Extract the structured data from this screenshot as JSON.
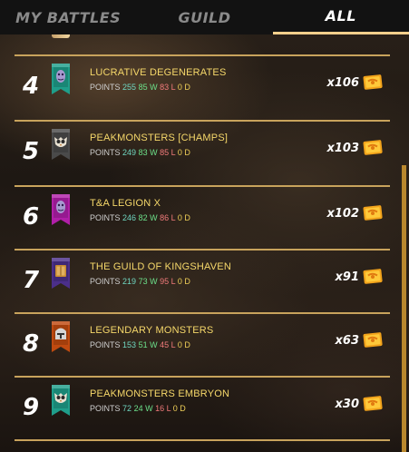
{
  "tabs": [
    {
      "label": "MY BATTLES",
      "active": false
    },
    {
      "label": "GUILD",
      "active": false
    },
    {
      "label": "ALL",
      "active": true
    }
  ],
  "colors": {
    "accent": "#f3cf8c",
    "guild_name": "#f6d86a",
    "points": "#6fd6c0",
    "wins": "#6ce08a",
    "losses": "#f07a7a",
    "draws": "#f0d058",
    "divider": "#c8a35c",
    "scrollbar": "#b9882e"
  },
  "rows": [
    {
      "rank": "4",
      "name": "LUCRATIVE DEGENERATES",
      "points_label": "POINTS",
      "points": "255",
      "w": "85 W",
      "l": "83 L",
      "d": "0 D",
      "multiplier": "x106",
      "banner": {
        "color": "#1f9e8a",
        "icon": "monster-icon"
      }
    },
    {
      "rank": "5",
      "name": "PEAKMONSTERS [CHAMPS]",
      "points_label": "POINTS",
      "points": "249",
      "w": "83 W",
      "l": "85 L",
      "d": "0 D",
      "multiplier": "x103",
      "banner": {
        "color": "#4a4a4a",
        "icon": "owl-skull-icon"
      }
    },
    {
      "rank": "6",
      "name": "T&A LEGION X",
      "points_label": "POINTS",
      "points": "246",
      "w": "82 W",
      "l": "86 L",
      "d": "0 D",
      "multiplier": "x102",
      "banner": {
        "color": "#b01fa8",
        "icon": "monster-icon"
      }
    },
    {
      "rank": "7",
      "name": "THE GUILD OF KINGSHAVEN",
      "points_label": "POINTS",
      "points": "219",
      "w": "73 W",
      "l": "95 L",
      "d": "0 D",
      "multiplier": "x91",
      "banner": {
        "color": "#4b2f8a",
        "icon": "book-icon"
      }
    },
    {
      "rank": "8",
      "name": "LEGENDARY MONSTERS",
      "points_label": "POINTS",
      "points": "153",
      "w": "51 W",
      "l": "45 L",
      "d": "0 D",
      "multiplier": "x63",
      "banner": {
        "color": "#c04a10",
        "icon": "helmet-icon"
      }
    },
    {
      "rank": "9",
      "name": "PEAKMONSTERS EMBRYON",
      "points_label": "POINTS",
      "points": "72",
      "w": "24 W",
      "l": "16 L",
      "d": "0 D",
      "multiplier": "x30",
      "banner": {
        "color": "#1f9e8a",
        "icon": "owl-skull-icon"
      }
    }
  ]
}
